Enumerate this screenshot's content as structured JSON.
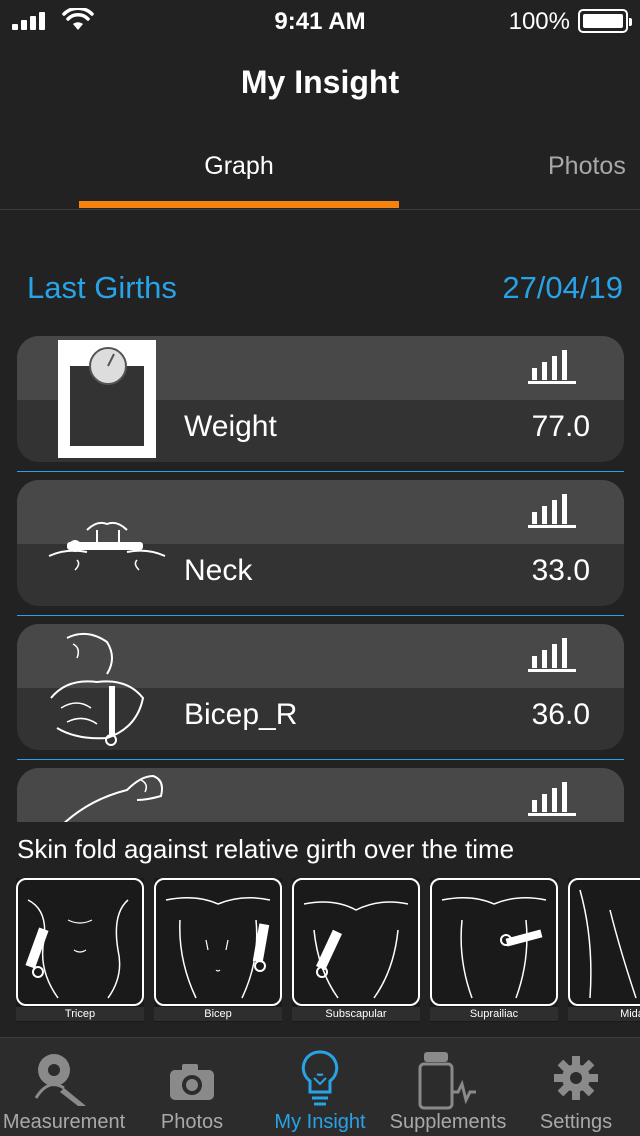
{
  "status": {
    "time": "9:41 AM",
    "battery": "100%"
  },
  "nav": {
    "title": "My Insight"
  },
  "tabs": {
    "graph": "Graph",
    "photos": "Photos"
  },
  "section": {
    "title": "Last Girths",
    "date": "27/04/19"
  },
  "girths": [
    {
      "label": "Weight",
      "value": "77.0",
      "icon": "scale-icon"
    },
    {
      "label": "Neck",
      "value": "33.0",
      "icon": "neck-measure-icon"
    },
    {
      "label": "Bicep_R",
      "value": "36.0",
      "icon": "bicep-measure-icon"
    },
    {
      "label": "",
      "value": "",
      "icon": "arm-measure-icon"
    }
  ],
  "skinfold": {
    "title": "Skin fold against relative girth over the time",
    "items": [
      "Tricep",
      "Bicep",
      "Subscapular",
      "Suprailiac",
      "Mida"
    ]
  },
  "tabbar": {
    "items": [
      {
        "label": "Measurement",
        "icon": "measuring-tape-icon"
      },
      {
        "label": "Photos",
        "icon": "camera-icon"
      },
      {
        "label": "My Insight",
        "icon": "lightbulb-icon",
        "active": true
      },
      {
        "label": "Supplements",
        "icon": "supplements-icon"
      },
      {
        "label": "Settings",
        "icon": "gear-icon"
      }
    ]
  },
  "colors": {
    "accent": "#29a3e8",
    "tab_indicator": "#f5830d",
    "background": "#222222"
  }
}
